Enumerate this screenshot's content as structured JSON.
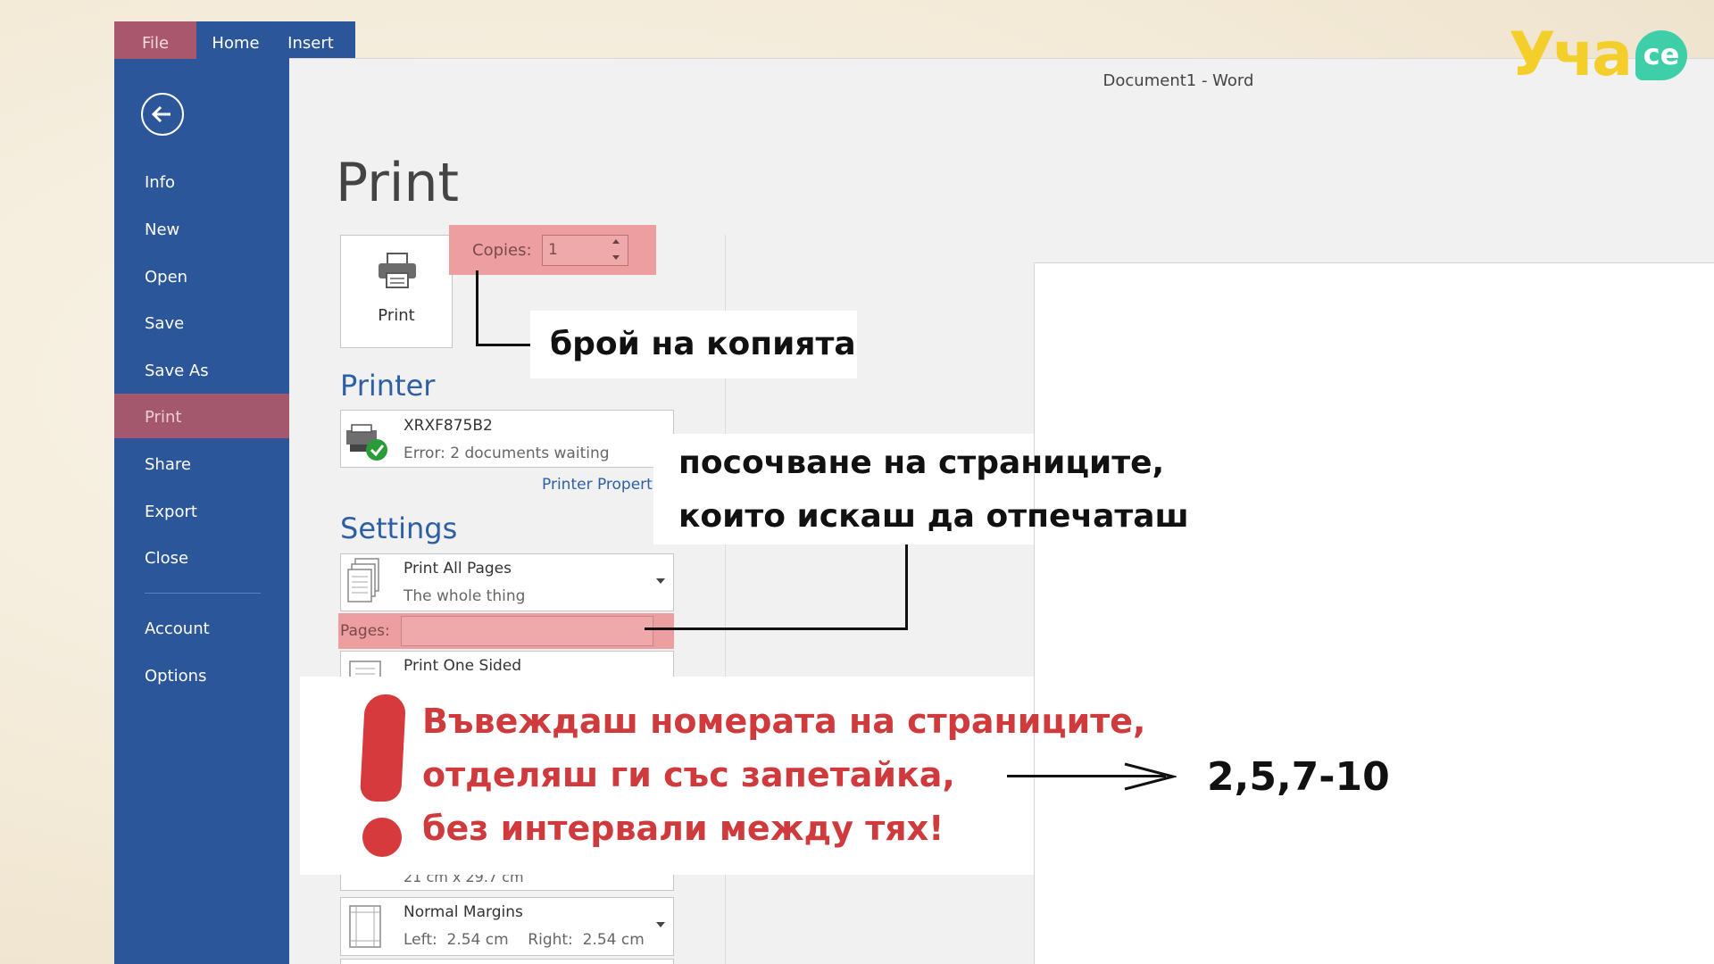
{
  "ribbon": {
    "tabs": [
      "File",
      "Home",
      "Insert"
    ]
  },
  "window": {
    "title": "Document1 - Word"
  },
  "sidebar": {
    "items": [
      "Info",
      "New",
      "Open",
      "Save",
      "Save As",
      "Print",
      "Share",
      "Export",
      "Close",
      "Account",
      "Options"
    ],
    "active": "Print"
  },
  "print": {
    "heading": "Print",
    "button_label": "Print",
    "copies_label": "Copies:",
    "copies_value": "1"
  },
  "printer": {
    "heading": "Printer",
    "name": "XRXF875B2",
    "status": "Error: 2 documents waiting",
    "properties_link": "Printer Properti"
  },
  "settings": {
    "heading": "Settings",
    "print_range": {
      "main": "Print All Pages",
      "sub": "The whole thing"
    },
    "pages_label": "Pages:",
    "sided": {
      "main": "Print One Sided"
    },
    "paper_size": {
      "sub": "21 cm x 29.7 cm"
    },
    "margins": {
      "main": "Normal Margins",
      "sub": "Left:  2.54 cm    Right:  2.54 cm"
    }
  },
  "annotations": {
    "copies_note": "брой на копията",
    "pages_note_line1": "посочване на страниците,",
    "pages_note_line2": "които искаш да отпечаташ",
    "warning_lines": [
      "Въвеждаш номерата на страниците,",
      "отделяш ги със запетайка,",
      "без интервали между тях!"
    ],
    "example": "2,5,7-10"
  },
  "logo": {
    "text": "Уча",
    "badge": "се"
  },
  "colors": {
    "word_blue": "#2b579a",
    "highlight": "#ed9ea0",
    "active_nav": "#a3586e",
    "warning_red": "#d63a3d",
    "logo_yellow": "#f4cf2c",
    "logo_green": "#3ecfa9"
  }
}
